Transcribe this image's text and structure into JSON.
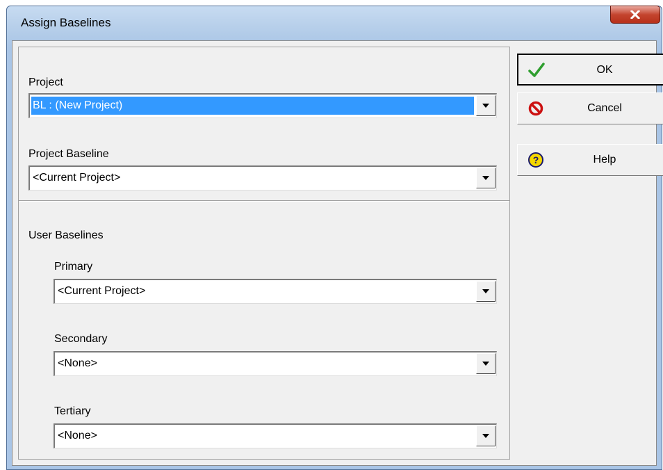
{
  "window": {
    "title": "Assign Baselines",
    "close_icon": "close-x-icon",
    "accent_color": "#c4452f"
  },
  "project": {
    "label": "Project",
    "value": "BL : (New Project)"
  },
  "project_baseline": {
    "label": "Project Baseline",
    "value": "<Current Project>"
  },
  "user_baselines": {
    "label": "User Baselines",
    "primary": {
      "label": "Primary",
      "value": "<Current Project>"
    },
    "secondary": {
      "label": "Secondary",
      "value": "<None>"
    },
    "tertiary": {
      "label": "Tertiary",
      "value": "<None>"
    }
  },
  "buttons": {
    "ok": {
      "label": "OK",
      "icon": "checkmark-icon",
      "color": "#2e9e2e"
    },
    "cancel": {
      "label": "Cancel",
      "icon": "no-entry-icon",
      "color": "#cc1111"
    },
    "help": {
      "label": "Help",
      "icon": "question-icon",
      "color": "#e8c800"
    }
  }
}
